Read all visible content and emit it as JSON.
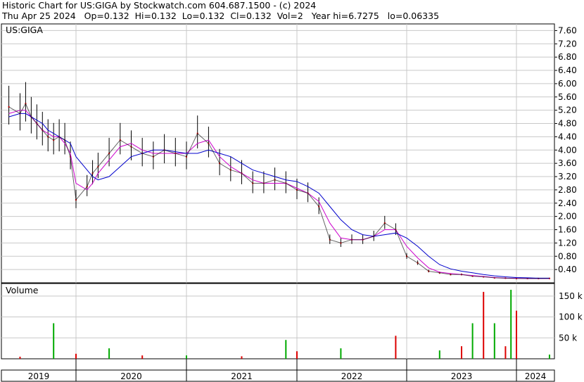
{
  "header": {
    "line1": "Historic Chart for US:GIGA by Stockwatch.com 604.687.1500 - (c) 2024",
    "line2": "Thu Apr 25 2024   Op=0.132  Hi=0.132  Lo=0.132  Cl=0.132  Vol=2   Year hi=6.7275   lo=0.06335"
  },
  "panels": {
    "price_label": "US:GIGA",
    "volume_label": "Volume"
  },
  "colors": {
    "price_bar": "#000000",
    "ma_short": "#cc00cc",
    "ma_long": "#0000cc",
    "vol_up": "#00aa00",
    "vol_down": "#dd0000",
    "close_marker": "#dd0000",
    "grid": "#c8c8c8"
  },
  "chart_data": [
    {
      "type": "line",
      "title": "US:GIGA",
      "x_axis_labels": [
        "2019",
        "2020",
        "2021",
        "2022",
        "2023",
        "2024"
      ],
      "y_ticks": [
        0.4,
        0.8,
        1.2,
        1.6,
        2.0,
        2.4,
        2.8,
        3.2,
        3.6,
        4.0,
        4.4,
        4.8,
        5.2,
        5.6,
        6.0,
        6.4,
        6.8,
        7.2,
        7.6
      ],
      "ylim": [
        0.0,
        7.8
      ],
      "x": [
        2018.8,
        2019.0,
        2019.1,
        2019.2,
        2019.3,
        2019.4,
        2019.5,
        2019.6,
        2019.7,
        2019.8,
        2019.9,
        2020.0,
        2020.1,
        2020.15,
        2020.2,
        2020.3,
        2020.4,
        2020.5,
        2020.6,
        2020.7,
        2020.8,
        2020.9,
        2021.0,
        2021.1,
        2021.2,
        2021.3,
        2021.4,
        2021.5,
        2021.6,
        2021.7,
        2021.8,
        2021.9,
        2022.0,
        2022.1,
        2022.2,
        2022.3,
        2022.4,
        2022.5,
        2022.6,
        2022.7,
        2022.8,
        2022.9,
        2023.0,
        2023.1,
        2023.2,
        2023.3,
        2023.4,
        2023.5,
        2023.6,
        2023.7,
        2023.8,
        2023.9,
        2024.0,
        2024.1,
        2024.2,
        2024.3
      ],
      "series": [
        {
          "role": "close",
          "values": [
            5.3,
            5.1,
            5.4,
            5.0,
            4.8,
            4.6,
            4.4,
            4.3,
            4.4,
            4.3,
            3.8,
            2.5,
            2.9,
            3.3,
            3.5,
            3.9,
            4.3,
            4.1,
            3.9,
            3.8,
            4.0,
            3.9,
            3.8,
            4.5,
            4.2,
            3.6,
            3.4,
            3.3,
            3.0,
            3.0,
            3.1,
            3.0,
            2.8,
            2.7,
            2.3,
            1.3,
            1.2,
            1.3,
            1.3,
            1.4,
            1.8,
            1.6,
            0.8,
            0.6,
            0.35,
            0.3,
            0.25,
            0.25,
            0.2,
            0.18,
            0.15,
            0.14,
            0.13,
            0.13,
            0.13,
            0.132
          ]
        },
        {
          "role": "ma_short",
          "values": [
            5.1,
            5.2,
            5.2,
            5.0,
            4.8,
            4.6,
            4.5,
            4.4,
            4.4,
            4.2,
            3.9,
            3.0,
            2.8,
            3.0,
            3.3,
            3.7,
            4.1,
            4.2,
            4.0,
            3.9,
            3.9,
            3.9,
            3.9,
            4.2,
            4.3,
            3.8,
            3.5,
            3.3,
            3.1,
            3.0,
            3.0,
            3.0,
            2.85,
            2.7,
            2.45,
            1.8,
            1.35,
            1.3,
            1.3,
            1.4,
            1.6,
            1.6,
            1.1,
            0.75,
            0.45,
            0.32,
            0.28,
            0.25,
            0.22,
            0.19,
            0.16,
            0.14,
            0.135,
            0.13,
            0.13,
            0.13
          ]
        },
        {
          "role": "ma_long",
          "values": [
            5.0,
            5.1,
            5.1,
            5.0,
            4.9,
            4.8,
            4.6,
            4.5,
            4.4,
            4.3,
            4.2,
            3.8,
            3.4,
            3.2,
            3.1,
            3.2,
            3.5,
            3.8,
            3.9,
            4.0,
            4.0,
            3.95,
            3.9,
            3.9,
            4.0,
            3.9,
            3.8,
            3.6,
            3.4,
            3.3,
            3.2,
            3.1,
            3.05,
            2.9,
            2.7,
            2.3,
            1.9,
            1.6,
            1.45,
            1.4,
            1.45,
            1.5,
            1.35,
            1.1,
            0.8,
            0.55,
            0.42,
            0.35,
            0.3,
            0.25,
            0.21,
            0.18,
            0.16,
            0.15,
            0.14,
            0.14
          ]
        }
      ]
    },
    {
      "type": "bar",
      "title": "Volume",
      "y_ticks": [
        50000,
        100000,
        150000
      ],
      "y_tick_labels": [
        "50 k",
        "100 k",
        "150 k"
      ],
      "ylim": [
        0,
        180000
      ],
      "x": [
        2019.0,
        2019.6,
        2020.0,
        2020.3,
        2020.6,
        2021.0,
        2021.5,
        2021.9,
        2022.0,
        2022.4,
        2022.9,
        2023.3,
        2023.5,
        2023.6,
        2023.7,
        2023.8,
        2023.9,
        2023.95,
        2024.0,
        2024.3
      ],
      "values": [
        5000,
        85000,
        12000,
        25000,
        8000,
        8000,
        6000,
        45000,
        18000,
        25000,
        55000,
        20000,
        30000,
        85000,
        160000,
        85000,
        30000,
        165000,
        115000,
        10000
      ]
    }
  ]
}
